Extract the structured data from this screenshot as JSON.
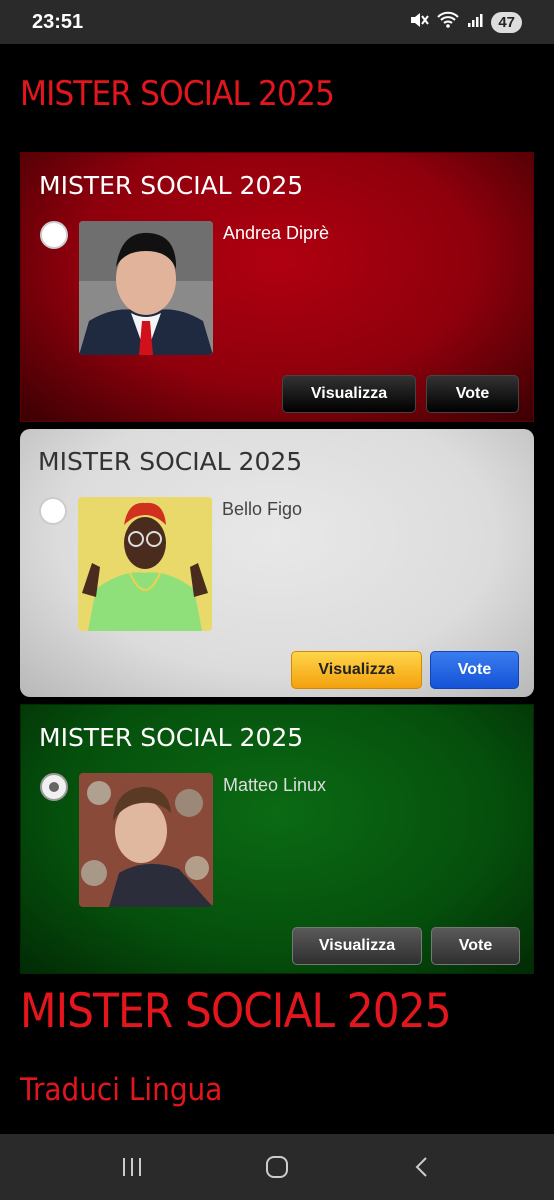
{
  "status_bar": {
    "time": "23:51",
    "battery": "47",
    "icons": [
      "mute-icon",
      "wifi-icon",
      "signal-icon"
    ]
  },
  "page": {
    "title": "MISTER SOCIAL 2025",
    "footer_title": "MISTER SOCIAL 2025",
    "translate_label": "Traduci Lingua"
  },
  "cards": [
    {
      "title": "MISTER SOCIAL 2025",
      "candidate": "Andrea Diprè",
      "view_label": "Visualizza",
      "vote_label": "Vote",
      "selected": false,
      "theme": "#a0000e"
    },
    {
      "title": "MISTER SOCIAL 2025",
      "candidate": "Bello Figo",
      "view_label": "Visualizza",
      "vote_label": "Vote",
      "selected": false,
      "theme": "#dcdcdc"
    },
    {
      "title": "MISTER SOCIAL 2025",
      "candidate": "Matteo Linux",
      "view_label": "Visualizza",
      "vote_label": "Vote",
      "selected": true,
      "theme": "#06570e"
    }
  ],
  "nav": [
    "recent-apps-icon",
    "home-icon",
    "back-icon"
  ]
}
